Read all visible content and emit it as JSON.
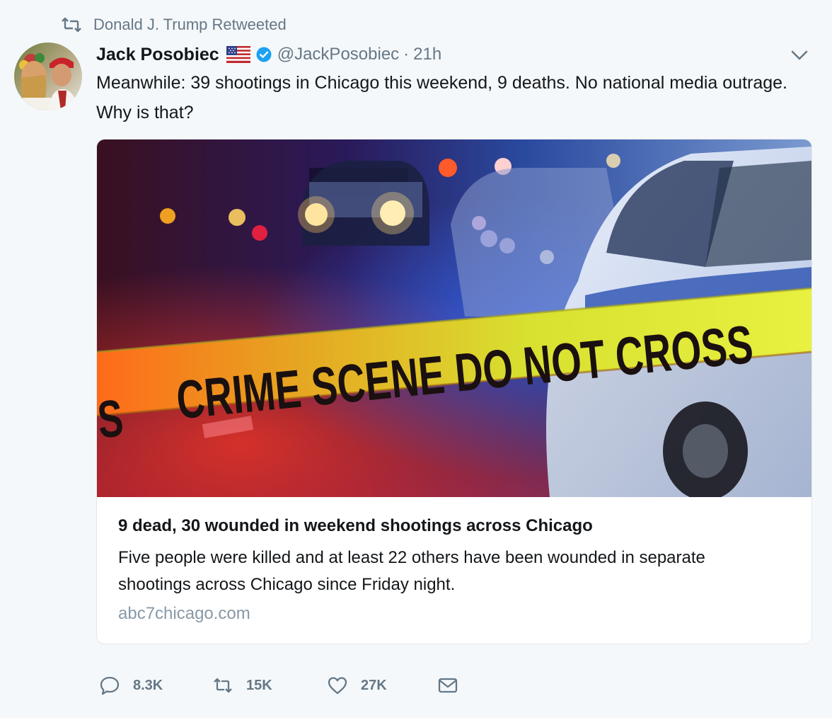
{
  "retweet_context": {
    "text": "Donald J. Trump Retweeted"
  },
  "author": {
    "name": "Jack Posobiec",
    "handle": "@JackPosobiec",
    "time": "21h",
    "separator": "·"
  },
  "tweet": {
    "text": "Meanwhile: 39 shootings in Chicago this weekend, 9 deaths. No national media outrage. Why is that?"
  },
  "card": {
    "image_text": "CRIME SCENE DO NOT CROSS",
    "image_text_fragment": "S",
    "title": "9 dead, 30 wounded in weekend shootings across Chicago",
    "description": "Five people were killed and at least 22 others have been wounded in separate shootings across Chicago since Friday night.",
    "domain": "abc7chicago.com"
  },
  "actions": {
    "replies": "8.3K",
    "retweets": "15K",
    "likes": "27K"
  },
  "colors": {
    "background": "#f5f8fa",
    "text": "#14171a",
    "muted": "#657786",
    "verified": "#1da1f2",
    "tape": "#e8e21a"
  },
  "icons": [
    "retweet-icon",
    "flag-us-icon",
    "verified-icon",
    "chevron-down-icon",
    "reply-icon",
    "like-icon",
    "direct-message-icon"
  ]
}
